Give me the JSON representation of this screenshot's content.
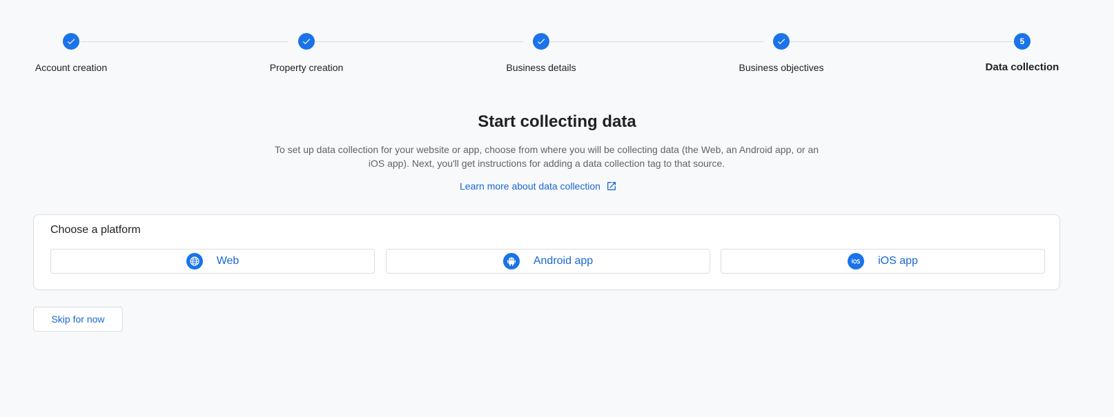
{
  "stepper": {
    "steps": [
      {
        "label": "Account creation",
        "state": "complete"
      },
      {
        "label": "Property creation",
        "state": "complete"
      },
      {
        "label": "Business details",
        "state": "complete"
      },
      {
        "label": "Business objectives",
        "state": "complete"
      },
      {
        "label": "Data collection",
        "state": "current",
        "number": "5"
      }
    ]
  },
  "main": {
    "title": "Start collecting data",
    "description": "To set up data collection for your website or app, choose from where you will be collecting data (the Web, an Android app, or an iOS app). Next, you'll get instructions for adding a data collection tag to that source.",
    "learn_more_link": "Learn more about data collection",
    "learn_more_icon": "open-in-new-icon"
  },
  "platform_card": {
    "title": "Choose a platform",
    "options": [
      {
        "label": "Web",
        "icon": "globe-icon"
      },
      {
        "label": "Android app",
        "icon": "android-icon"
      },
      {
        "label": "iOS app",
        "icon": "ios-icon"
      }
    ]
  },
  "actions": {
    "skip_label": "Skip for now"
  },
  "colors": {
    "accent": "#1a73e8",
    "link": "#1967d2",
    "background": "#f8f9fb",
    "border": "#dadce0"
  }
}
